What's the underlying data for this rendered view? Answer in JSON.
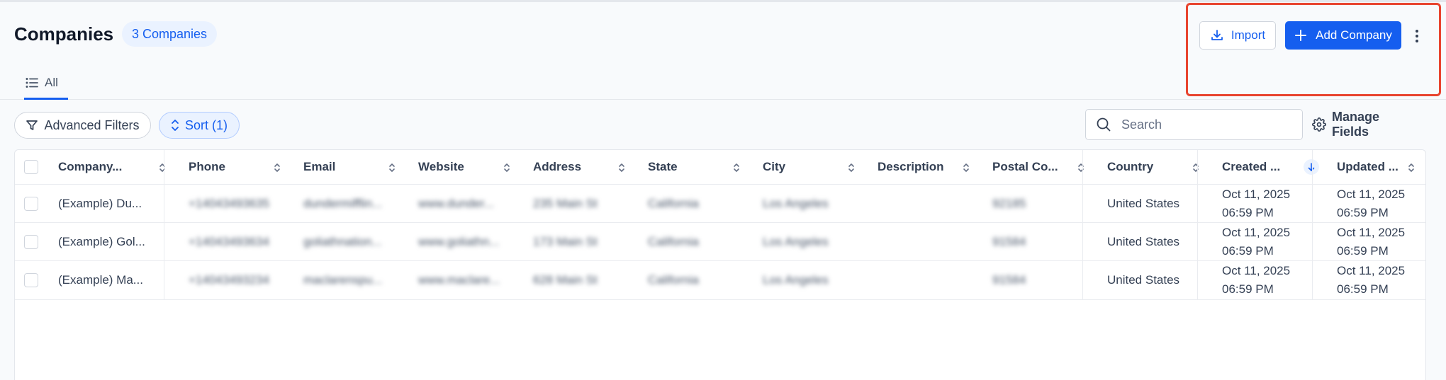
{
  "header": {
    "title": "Companies",
    "count_badge": "3 Companies",
    "import_label": "Import",
    "add_label": "Add Company"
  },
  "tabs": [
    {
      "label": "All",
      "active": true
    }
  ],
  "toolbar": {
    "filters_label": "Advanced Filters",
    "sort_label": "Sort (1)",
    "search_placeholder": "Search",
    "manage_fields_label": "Manage Fields"
  },
  "table": {
    "columns": [
      "Company...",
      "Phone",
      "Email",
      "Website",
      "Address",
      "State",
      "City",
      "Description",
      "Postal Co...",
      "Country",
      "Created ...",
      "Updated ..."
    ],
    "rows": [
      {
        "company": "(Example) Du...",
        "phone": "+14043493635",
        "email": "dundermifflin...",
        "website": "www.dunder...",
        "address": "235 Main St",
        "state": "California",
        "city": "Los Angeles",
        "description": "",
        "postal": "92185",
        "country": "United States",
        "created_date": "Oct 11, 2025",
        "created_time": "06:59 PM",
        "updated_date": "Oct 11, 2025",
        "updated_time": "06:59 PM"
      },
      {
        "company": "(Example) Gol...",
        "phone": "+14043493634",
        "email": "goliathnation...",
        "website": "www.goliathn...",
        "address": "173 Main St",
        "state": "California",
        "city": "Los Angeles",
        "description": "",
        "postal": "91584",
        "country": "United States",
        "created_date": "Oct 11, 2025",
        "created_time": "06:59 PM",
        "updated_date": "Oct 11, 2025",
        "updated_time": "06:59 PM"
      },
      {
        "company": "(Example) Ma...",
        "phone": "+14043493234",
        "email": "maclarenspu...",
        "website": "www.maclare...",
        "address": "628 Main St",
        "state": "California",
        "city": "Los Angeles",
        "description": "",
        "postal": "91584",
        "country": "United States",
        "created_date": "Oct 11, 2025",
        "created_time": "06:59 PM",
        "updated_date": "Oct 11, 2025",
        "updated_time": "06:59 PM"
      }
    ]
  },
  "colors": {
    "accent": "#155eef",
    "annotation_highlight": "#e8442f"
  },
  "icons": [
    "download-icon",
    "plus-icon",
    "kebab-menu-icon",
    "list-icon",
    "filter-icon",
    "sort-icon",
    "search-icon",
    "gear-icon",
    "sort-arrow-down-icon"
  ]
}
